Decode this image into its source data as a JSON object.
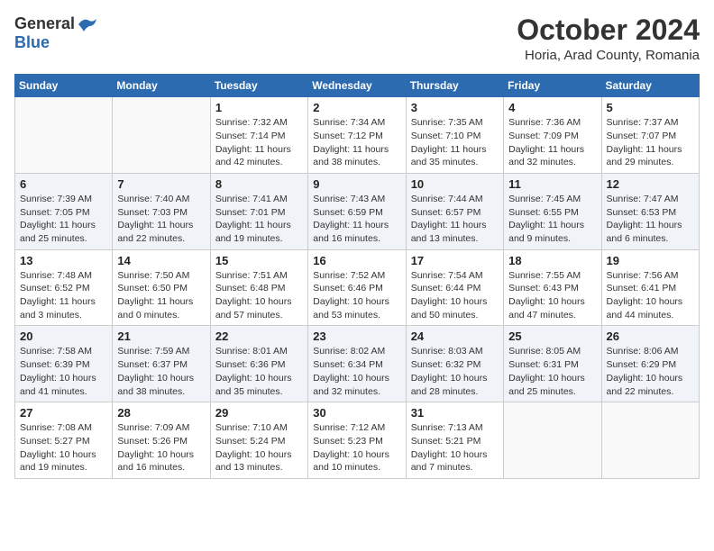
{
  "header": {
    "logo_general": "General",
    "logo_blue": "Blue",
    "month_title": "October 2024",
    "location": "Horia, Arad County, Romania"
  },
  "columns": [
    "Sunday",
    "Monday",
    "Tuesday",
    "Wednesday",
    "Thursday",
    "Friday",
    "Saturday"
  ],
  "weeks": [
    [
      {
        "day": "",
        "sunrise": "",
        "sunset": "",
        "daylight": ""
      },
      {
        "day": "",
        "sunrise": "",
        "sunset": "",
        "daylight": ""
      },
      {
        "day": "1",
        "sunrise": "Sunrise: 7:32 AM",
        "sunset": "Sunset: 7:14 PM",
        "daylight": "Daylight: 11 hours and 42 minutes."
      },
      {
        "day": "2",
        "sunrise": "Sunrise: 7:34 AM",
        "sunset": "Sunset: 7:12 PM",
        "daylight": "Daylight: 11 hours and 38 minutes."
      },
      {
        "day": "3",
        "sunrise": "Sunrise: 7:35 AM",
        "sunset": "Sunset: 7:10 PM",
        "daylight": "Daylight: 11 hours and 35 minutes."
      },
      {
        "day": "4",
        "sunrise": "Sunrise: 7:36 AM",
        "sunset": "Sunset: 7:09 PM",
        "daylight": "Daylight: 11 hours and 32 minutes."
      },
      {
        "day": "5",
        "sunrise": "Sunrise: 7:37 AM",
        "sunset": "Sunset: 7:07 PM",
        "daylight": "Daylight: 11 hours and 29 minutes."
      }
    ],
    [
      {
        "day": "6",
        "sunrise": "Sunrise: 7:39 AM",
        "sunset": "Sunset: 7:05 PM",
        "daylight": "Daylight: 11 hours and 25 minutes."
      },
      {
        "day": "7",
        "sunrise": "Sunrise: 7:40 AM",
        "sunset": "Sunset: 7:03 PM",
        "daylight": "Daylight: 11 hours and 22 minutes."
      },
      {
        "day": "8",
        "sunrise": "Sunrise: 7:41 AM",
        "sunset": "Sunset: 7:01 PM",
        "daylight": "Daylight: 11 hours and 19 minutes."
      },
      {
        "day": "9",
        "sunrise": "Sunrise: 7:43 AM",
        "sunset": "Sunset: 6:59 PM",
        "daylight": "Daylight: 11 hours and 16 minutes."
      },
      {
        "day": "10",
        "sunrise": "Sunrise: 7:44 AM",
        "sunset": "Sunset: 6:57 PM",
        "daylight": "Daylight: 11 hours and 13 minutes."
      },
      {
        "day": "11",
        "sunrise": "Sunrise: 7:45 AM",
        "sunset": "Sunset: 6:55 PM",
        "daylight": "Daylight: 11 hours and 9 minutes."
      },
      {
        "day": "12",
        "sunrise": "Sunrise: 7:47 AM",
        "sunset": "Sunset: 6:53 PM",
        "daylight": "Daylight: 11 hours and 6 minutes."
      }
    ],
    [
      {
        "day": "13",
        "sunrise": "Sunrise: 7:48 AM",
        "sunset": "Sunset: 6:52 PM",
        "daylight": "Daylight: 11 hours and 3 minutes."
      },
      {
        "day": "14",
        "sunrise": "Sunrise: 7:50 AM",
        "sunset": "Sunset: 6:50 PM",
        "daylight": "Daylight: 11 hours and 0 minutes."
      },
      {
        "day": "15",
        "sunrise": "Sunrise: 7:51 AM",
        "sunset": "Sunset: 6:48 PM",
        "daylight": "Daylight: 10 hours and 57 minutes."
      },
      {
        "day": "16",
        "sunrise": "Sunrise: 7:52 AM",
        "sunset": "Sunset: 6:46 PM",
        "daylight": "Daylight: 10 hours and 53 minutes."
      },
      {
        "day": "17",
        "sunrise": "Sunrise: 7:54 AM",
        "sunset": "Sunset: 6:44 PM",
        "daylight": "Daylight: 10 hours and 50 minutes."
      },
      {
        "day": "18",
        "sunrise": "Sunrise: 7:55 AM",
        "sunset": "Sunset: 6:43 PM",
        "daylight": "Daylight: 10 hours and 47 minutes."
      },
      {
        "day": "19",
        "sunrise": "Sunrise: 7:56 AM",
        "sunset": "Sunset: 6:41 PM",
        "daylight": "Daylight: 10 hours and 44 minutes."
      }
    ],
    [
      {
        "day": "20",
        "sunrise": "Sunrise: 7:58 AM",
        "sunset": "Sunset: 6:39 PM",
        "daylight": "Daylight: 10 hours and 41 minutes."
      },
      {
        "day": "21",
        "sunrise": "Sunrise: 7:59 AM",
        "sunset": "Sunset: 6:37 PM",
        "daylight": "Daylight: 10 hours and 38 minutes."
      },
      {
        "day": "22",
        "sunrise": "Sunrise: 8:01 AM",
        "sunset": "Sunset: 6:36 PM",
        "daylight": "Daylight: 10 hours and 35 minutes."
      },
      {
        "day": "23",
        "sunrise": "Sunrise: 8:02 AM",
        "sunset": "Sunset: 6:34 PM",
        "daylight": "Daylight: 10 hours and 32 minutes."
      },
      {
        "day": "24",
        "sunrise": "Sunrise: 8:03 AM",
        "sunset": "Sunset: 6:32 PM",
        "daylight": "Daylight: 10 hours and 28 minutes."
      },
      {
        "day": "25",
        "sunrise": "Sunrise: 8:05 AM",
        "sunset": "Sunset: 6:31 PM",
        "daylight": "Daylight: 10 hours and 25 minutes."
      },
      {
        "day": "26",
        "sunrise": "Sunrise: 8:06 AM",
        "sunset": "Sunset: 6:29 PM",
        "daylight": "Daylight: 10 hours and 22 minutes."
      }
    ],
    [
      {
        "day": "27",
        "sunrise": "Sunrise: 7:08 AM",
        "sunset": "Sunset: 5:27 PM",
        "daylight": "Daylight: 10 hours and 19 minutes."
      },
      {
        "day": "28",
        "sunrise": "Sunrise: 7:09 AM",
        "sunset": "Sunset: 5:26 PM",
        "daylight": "Daylight: 10 hours and 16 minutes."
      },
      {
        "day": "29",
        "sunrise": "Sunrise: 7:10 AM",
        "sunset": "Sunset: 5:24 PM",
        "daylight": "Daylight: 10 hours and 13 minutes."
      },
      {
        "day": "30",
        "sunrise": "Sunrise: 7:12 AM",
        "sunset": "Sunset: 5:23 PM",
        "daylight": "Daylight: 10 hours and 10 minutes."
      },
      {
        "day": "31",
        "sunrise": "Sunrise: 7:13 AM",
        "sunset": "Sunset: 5:21 PM",
        "daylight": "Daylight: 10 hours and 7 minutes."
      },
      {
        "day": "",
        "sunrise": "",
        "sunset": "",
        "daylight": ""
      },
      {
        "day": "",
        "sunrise": "",
        "sunset": "",
        "daylight": ""
      }
    ]
  ]
}
